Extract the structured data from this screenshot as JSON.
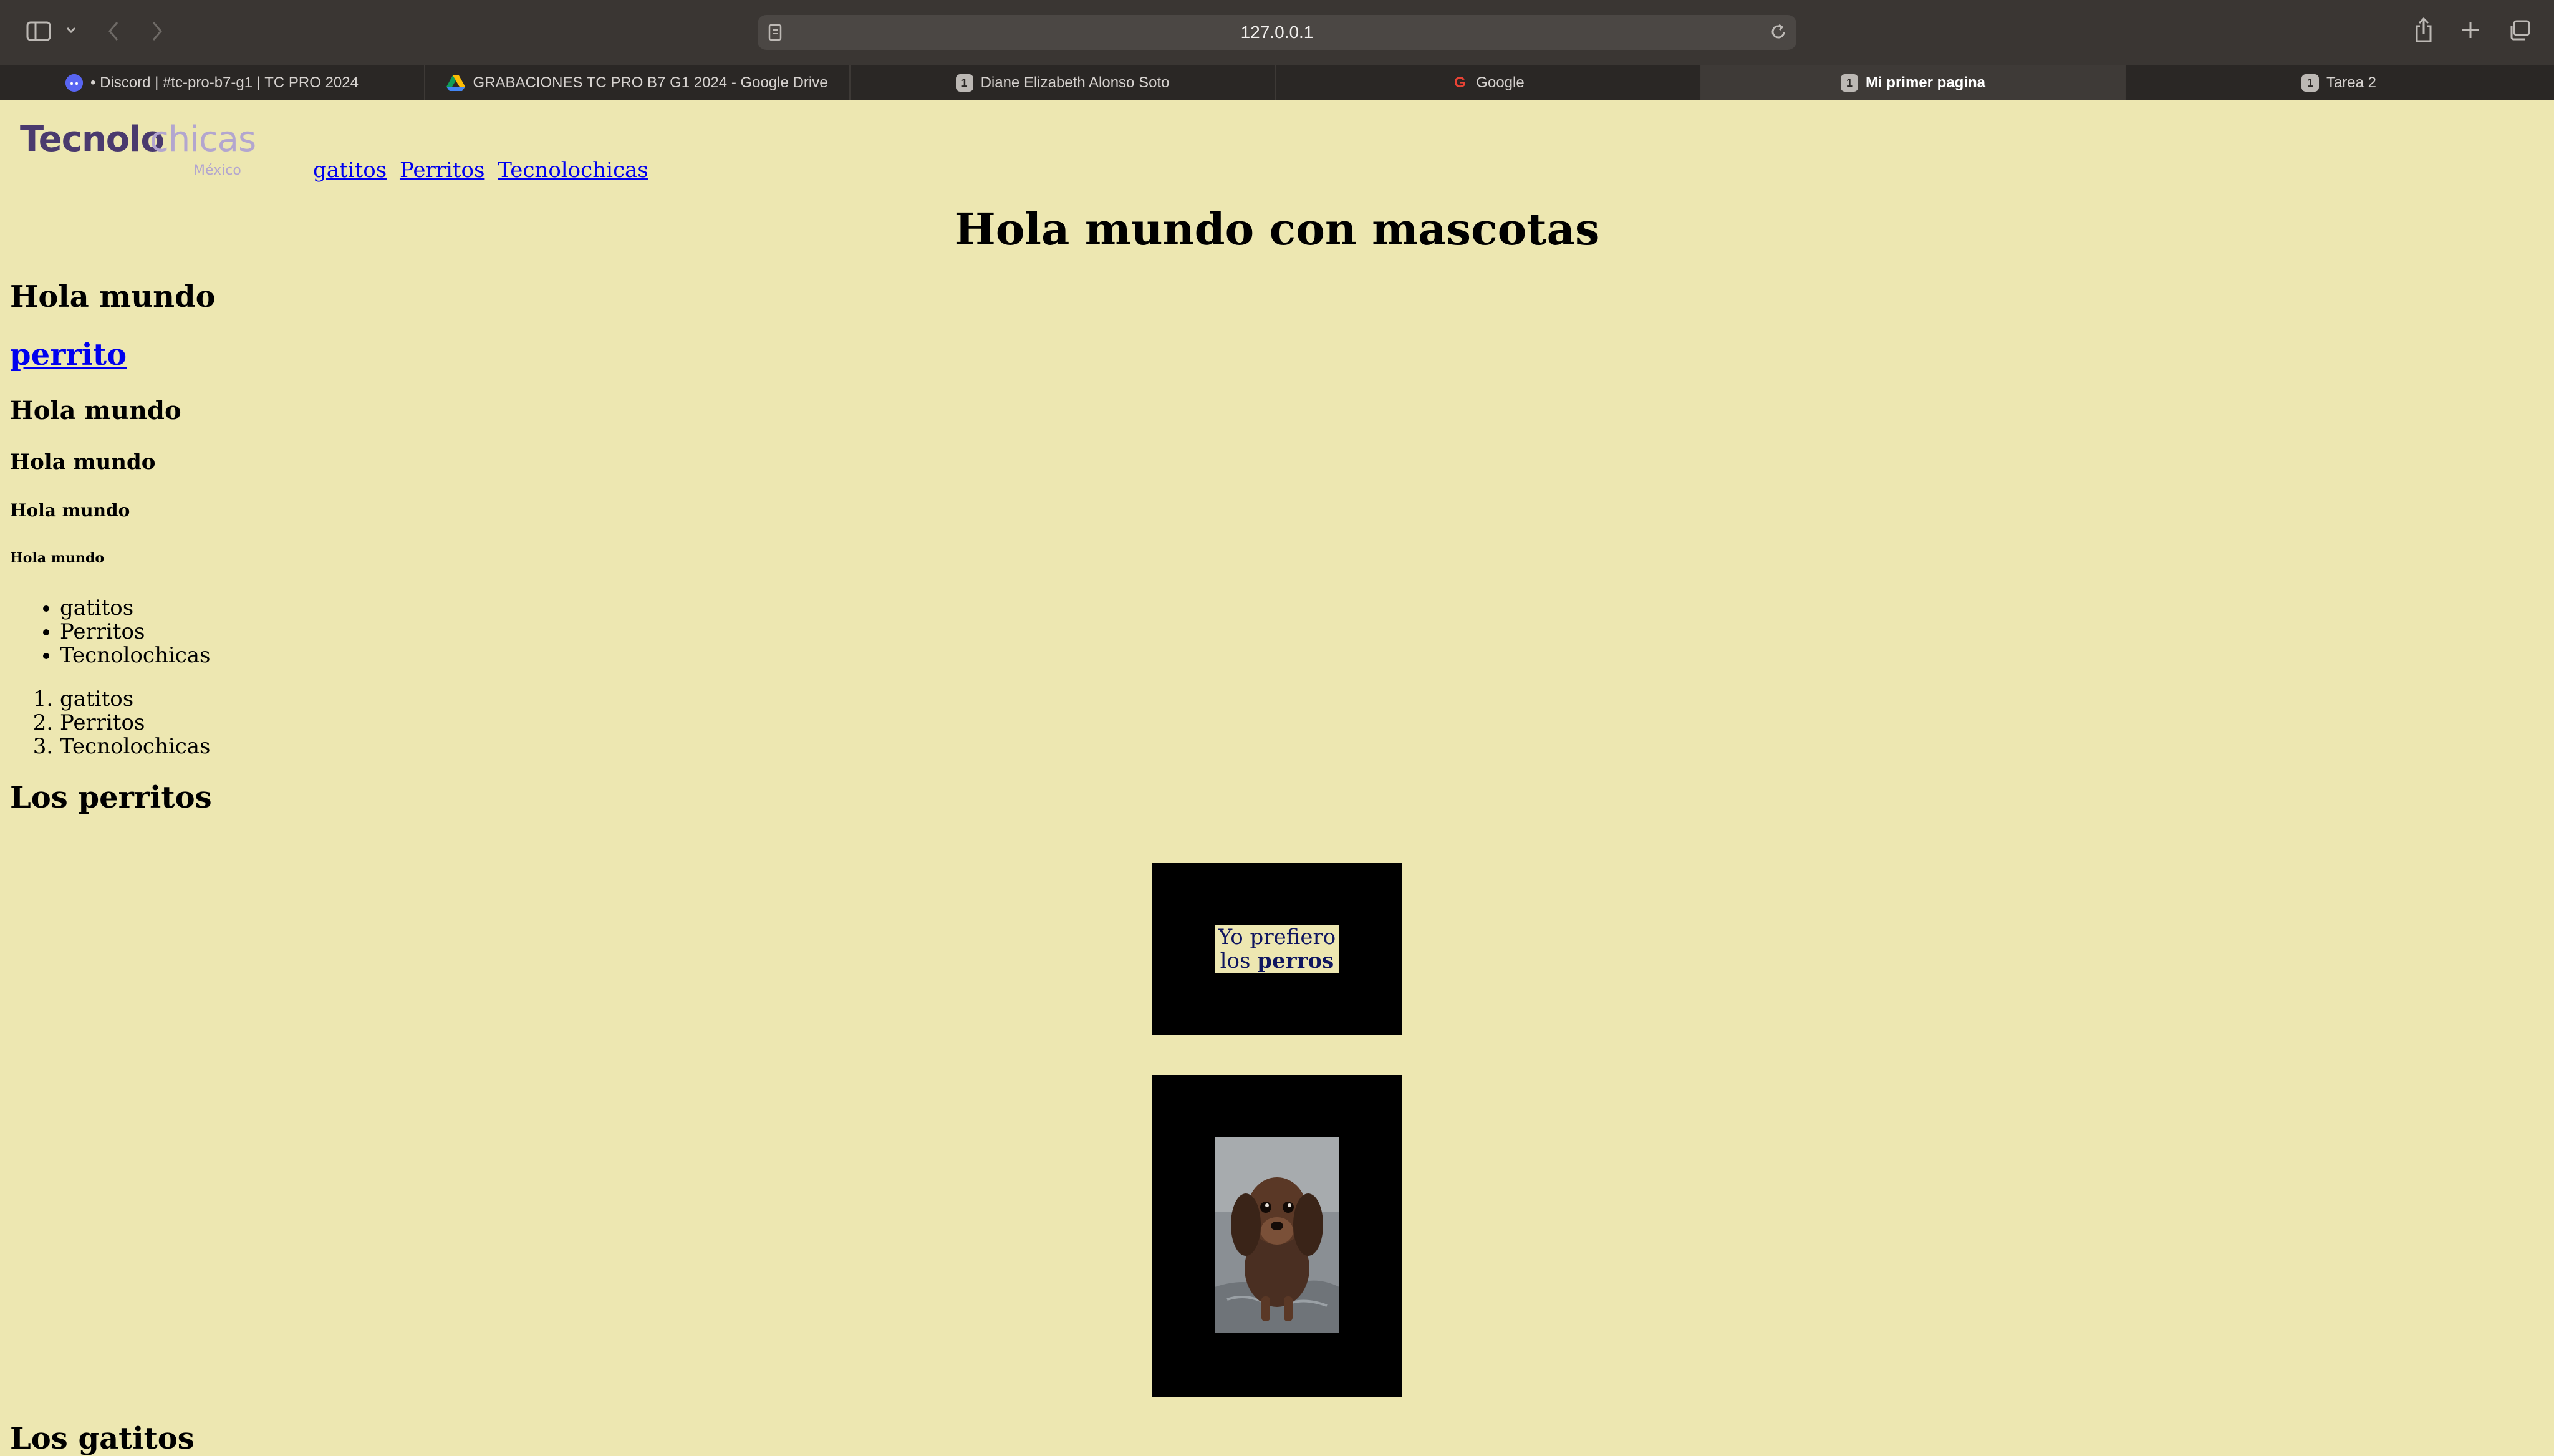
{
  "browser": {
    "url": "127.0.0.1",
    "tabs": [
      {
        "label": "• Discord | #tc-pro-b7-g1 | TC PRO 2024",
        "icon": "discord-icon"
      },
      {
        "label": "GRABACIONES TC PRO B7 G1 2024 - Google Drive",
        "icon": "drive-icon"
      },
      {
        "label": "Diane Elizabeth Alonso Soto",
        "icon": "page-icon"
      },
      {
        "label": "Google",
        "icon": "google-icon"
      },
      {
        "label": "Mi primer pagina",
        "icon": "page-icon",
        "active": true
      },
      {
        "label": "Tarea 2",
        "icon": "page-icon"
      }
    ],
    "tab_badge": "1",
    "google_glyph": "G"
  },
  "page": {
    "logo": {
      "tecno": "Tecnolo",
      "chicas": "chicas",
      "country": "México"
    },
    "nav_links": [
      "gatitos",
      "Perritos",
      "Tecnolochicas"
    ],
    "main_title": "Hola mundo con mascotas",
    "headings": {
      "h1": "Hola mundo",
      "h1_link": "perrito",
      "h2": "Hola mundo",
      "h3": "Hola mundo",
      "h4": "Hola mundo",
      "h5": "Hola mundo"
    },
    "unordered_list": [
      "gatitos",
      "Perritos",
      "Tecnolochicas"
    ],
    "ordered_list": [
      "gatitos",
      "Perritos",
      "Tecnolochicas"
    ],
    "section_title": "Los perritos",
    "prefer_box": {
      "text": "Yo prefiero los ",
      "bold": "perros"
    },
    "next_section_title": "Los gatitos"
  },
  "colors": {
    "page_background": "#ede7b1",
    "browser_chrome": "#3a3633",
    "link": "#0000ee",
    "logo_primary": "#4a3a6e",
    "logo_secondary": "#b3a6cf"
  }
}
